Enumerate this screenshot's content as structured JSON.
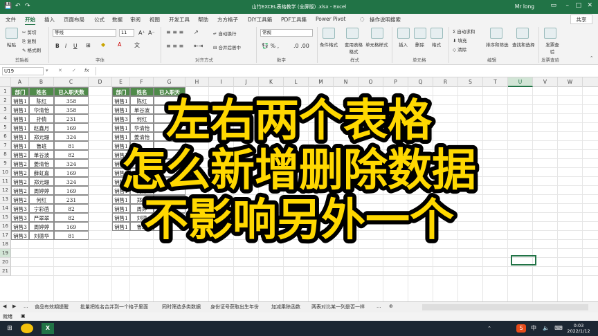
{
  "window": {
    "title": "山竹EXCEL表格教学 (全屏版) .xlsx  -  Excel",
    "user": "Mr long",
    "share": "共享"
  },
  "tabs": [
    "文件",
    "开始",
    "插入",
    "页面布局",
    "公式",
    "数据",
    "审阅",
    "视图",
    "开发工具",
    "帮助",
    "方方格子",
    "DIY工具箱",
    "PDF工具集",
    "Power Pivot",
    "操作说明搜索"
  ],
  "ribbon": {
    "clipboard": {
      "paste": "粘贴",
      "cut": "剪切",
      "copy": "复制",
      "format_painter": "格式刷",
      "label": "剪贴板"
    },
    "font": {
      "name": "等线",
      "size": "11",
      "bold": "B",
      "italic": "I",
      "underline": "U",
      "label": "字体"
    },
    "align": {
      "wrap": "自动换行",
      "merge": "合并后居中",
      "label": "对齐方式"
    },
    "number": {
      "format": "常规",
      "label": "数字"
    },
    "styles": {
      "conditional": "条件格式",
      "table": "套用表格格式",
      "cell": "单元格样式",
      "label": "样式"
    },
    "cells": {
      "insert": "插入",
      "delete": "删除",
      "format": "格式",
      "label": "单元格"
    },
    "editing": {
      "autosum": "自动求和",
      "fill": "填充",
      "clear": "清除",
      "sort": "排序和筛选",
      "find": "查找和选择",
      "label": "编辑"
    },
    "invoice": {
      "check": "发票查验",
      "label": "发票查验"
    }
  },
  "formula_bar": {
    "name_box": "U19",
    "fx": "fx",
    "value": ""
  },
  "columns": [
    "A",
    "B",
    "C",
    "D",
    "E",
    "F",
    "G",
    "H",
    "I",
    "J",
    "K",
    "L",
    "M",
    "N",
    "O",
    "P",
    "Q",
    "R",
    "S",
    "T",
    "U",
    "V",
    "W"
  ],
  "rows": [
    "1",
    "2",
    "3",
    "4",
    "5",
    "6",
    "7",
    "8",
    "9",
    "10",
    "11",
    "12",
    "13",
    "14",
    "15",
    "16",
    "17",
    "18",
    "19",
    "20",
    "21"
  ],
  "table_left": {
    "headers": [
      "部门",
      "姓名",
      "已入职天数"
    ],
    "rows": [
      [
        "销售1",
        "陈红",
        "358"
      ],
      [
        "销售1",
        "华清怡",
        "358"
      ],
      [
        "销售1",
        "孙倩",
        "231"
      ],
      [
        "销售1",
        "赵鑫月",
        "169"
      ],
      [
        "销售1",
        "郑元珊",
        "324"
      ],
      [
        "销售1",
        "鲁班",
        "81"
      ],
      [
        "销售2",
        "单谷波",
        "82"
      ],
      [
        "销售2",
        "姜清怡",
        "324"
      ],
      [
        "销售2",
        "薛虹嘉",
        "169"
      ],
      [
        "销售2",
        "郑元珊",
        "324"
      ],
      [
        "销售2",
        "周婷婷",
        "169"
      ],
      [
        "销售2",
        "何红",
        "231"
      ],
      [
        "销售3",
        "宁彩菡",
        "82"
      ],
      [
        "销售3",
        "严翠翠",
        "82"
      ],
      [
        "销售3",
        "周婷婷",
        "169"
      ],
      [
        "销售3",
        "刘德华",
        "81"
      ]
    ]
  },
  "table_right": {
    "headers": [
      "部门",
      "姓名",
      "已入职天"
    ],
    "rows": [
      [
        "销售1",
        "陈红",
        ""
      ],
      [
        "销售1",
        "单谷波",
        ""
      ],
      [
        "销售3",
        "何红",
        ""
      ],
      [
        "销售1",
        "华清怡",
        ""
      ],
      [
        "销售1",
        "姜清怡",
        "32"
      ],
      [
        "销售1",
        "",
        ""
      ],
      [
        "销售1",
        "",
        ""
      ],
      [
        "销售1",
        "",
        "80"
      ],
      [
        "销售1",
        "",
        ""
      ],
      [
        "销售1",
        "郑元",
        ""
      ],
      [
        "销售1",
        "周婷",
        ""
      ],
      [
        "销售1",
        "郑元",
        ""
      ],
      [
        "销售1",
        "周婷",
        ""
      ],
      [
        "销售1",
        "刘德",
        ""
      ],
      [
        "销售1",
        "鲁班",
        ""
      ]
    ]
  },
  "overlay": {
    "lines": [
      "左右两个表格",
      "怎么新增删除数据",
      "不影响另外一个"
    ],
    "fill_color": "#ffd800",
    "stroke_color": "#000000"
  },
  "sheet_tabs": [
    "...",
    "食品有效期提醒",
    "批量把姓名合并到一个格子里面",
    "同时筛选多类数据",
    "身份证号获取出生年份",
    "加减乘除函数",
    "两表对比某一列是否一样",
    "..."
  ],
  "status": {
    "ready": "就绪"
  },
  "taskbar": {
    "time": "0:03",
    "date": "2022/1/12",
    "lang": "中"
  }
}
